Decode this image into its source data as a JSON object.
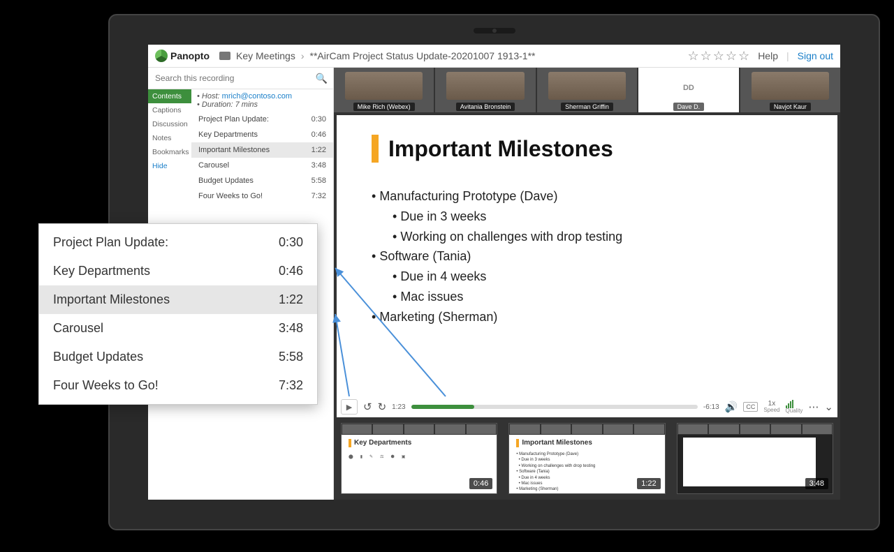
{
  "brand": "Panopto",
  "breadcrumb": {
    "folder": "Key Meetings",
    "title": "**AirCam Project Status Update-20201007 1913-1**"
  },
  "header": {
    "help": "Help",
    "signout": "Sign out"
  },
  "search": {
    "placeholder": "Search this recording"
  },
  "tabs": [
    "Contents",
    "Captions",
    "Discussion",
    "Notes",
    "Bookmarks",
    "Hide"
  ],
  "meta": {
    "host_label": "Host:",
    "host": "mrich@contoso.com",
    "duration_label": "Duration: 7 mins"
  },
  "toc": [
    {
      "label": "Project Plan Update:",
      "time": "0:30"
    },
    {
      "label": "Key Departments",
      "time": "0:46"
    },
    {
      "label": "Important Milestones",
      "time": "1:22"
    },
    {
      "label": "Carousel",
      "time": "3:48"
    },
    {
      "label": "Budget Updates",
      "time": "5:58"
    },
    {
      "label": "Four Weeks to Go!",
      "time": "7:32"
    }
  ],
  "participants": [
    {
      "name": "Mike Rich (Webex)"
    },
    {
      "name": "Avitania Bronstein"
    },
    {
      "name": "Sherman Griffin"
    },
    {
      "name": "Dave D.",
      "initials": "DD"
    },
    {
      "name": "Navjot Kaur"
    }
  ],
  "slide": {
    "title": "Important Milestones",
    "b1": "Manufacturing Prototype (Dave)",
    "b1a": "Due in 3 weeks",
    "b1b": "Working on challenges with drop testing",
    "b2": "Software (Tania)",
    "b2a": "Due in 4 weeks",
    "b2b": "Mac issues",
    "b3": "Marketing (Sherman)"
  },
  "controls": {
    "cur": "1:23",
    "rem": "-6:13",
    "speed": "1x",
    "speed_lbl": "Speed",
    "quality": "Quality",
    "cc": "CC"
  },
  "previews": [
    {
      "title": "Key Departments",
      "ts": "0:46"
    },
    {
      "title": "Important Milestones",
      "ts": "1:22"
    },
    {
      "title": "",
      "ts": "3:48"
    }
  ]
}
